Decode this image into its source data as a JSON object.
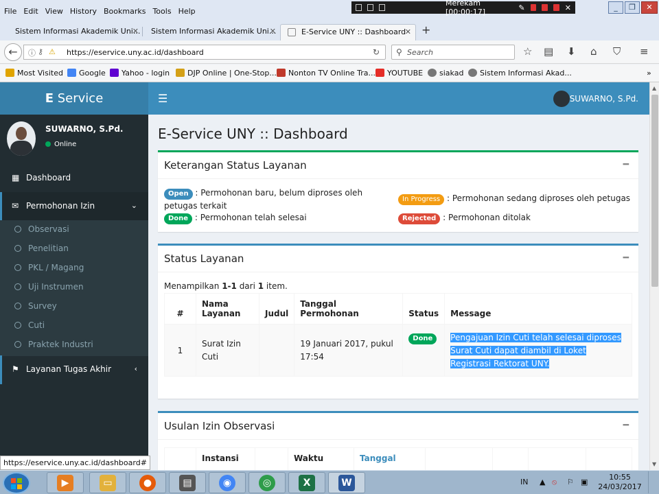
{
  "browser": {
    "menu": [
      "File",
      "Edit",
      "View",
      "History",
      "Bookmarks",
      "Tools",
      "Help"
    ],
    "recorder_title": "Merekam [00:00:17]",
    "tabs": [
      {
        "label": "Sistem Informasi Akademik Uni...",
        "active": false
      },
      {
        "label": "Sistem Informasi Akademik Uni...",
        "active": false
      },
      {
        "label": "E-Service UNY :: Dashboard",
        "active": true
      }
    ],
    "new_tab": "+",
    "url": "https://eservice.uny.ac.id/dashboard",
    "search_placeholder": "Search",
    "bookmarks": [
      {
        "label": "Most Visited",
        "icon": "bookmark-star-icon",
        "color": "#e0a400"
      },
      {
        "label": "Google",
        "icon": "google-icon",
        "color": "#4285f4"
      },
      {
        "label": "Yahoo - login",
        "icon": "yahoo-icon",
        "color": "#5f01d1"
      },
      {
        "label": "DJP Online | One-Stop...",
        "icon": "djp-icon",
        "color": "#d4a017"
      },
      {
        "label": "Nonton TV Online Tra...",
        "icon": "tv-icon",
        "color": "#c0392b"
      },
      {
        "label": "YOUTUBE",
        "icon": "youtube-icon",
        "color": "#e52d27"
      },
      {
        "label": "siakad",
        "icon": "globe-icon",
        "color": "#777"
      },
      {
        "label": "Sistem Informasi Akad...",
        "icon": "globe-icon",
        "color": "#777"
      }
    ],
    "overflow": "»",
    "status_url": "https://eservice.uny.ac.id/dashboard#"
  },
  "app": {
    "logo_bold": "E",
    "logo_rest": " Service",
    "header_user": "SUWARNO, S.Pd.",
    "colors": {
      "header": "#3c8dbc",
      "logo": "#367fa9",
      "sidebar": "#222d32",
      "success": "#00a65a",
      "warning": "#f39c12",
      "danger": "#dd4b39"
    }
  },
  "sidebar": {
    "user_name": "SUWARNO, S.Pd.",
    "user_status": "Online",
    "items": [
      {
        "label": "Dashboard",
        "icon": "dashboard-icon"
      },
      {
        "label": "Permohonan Izin",
        "icon": "envelope-icon"
      },
      {
        "label": "Layanan Tugas Akhir",
        "icon": "flag-icon"
      }
    ],
    "submenu": [
      "Observasi",
      "Penelitian",
      "PKL / Magang",
      "Uji Instrumen",
      "Survey",
      "Cuti",
      "Praktek Industri"
    ]
  },
  "main": {
    "title": "E-Service UNY :: Dashboard",
    "legend_box": {
      "title": "Keterangan Status Layanan",
      "items": [
        {
          "badge": "Open",
          "text": ": Permohonan baru, belum diproses oleh petugas terkait"
        },
        {
          "badge": "In Progress",
          "text": ": Permohonan sedang diproses oleh petugas"
        },
        {
          "badge": "Done",
          "text": ": Permohonan telah selesai"
        },
        {
          "badge": "Rejected",
          "text": ": Permohonan ditolak"
        }
      ]
    },
    "status_box": {
      "title": "Status Layanan",
      "summary_prefix": "Menampilkan ",
      "summary_range": "1-1",
      "summary_mid": " dari ",
      "summary_total": "1",
      "summary_suffix": " item.",
      "columns": [
        "#",
        "Nama Layanan",
        "Judul",
        "Tanggal Permohonan",
        "Status",
        "Message"
      ],
      "rows": [
        {
          "no": "1",
          "nama": "Surat Izin Cuti",
          "judul": "",
          "tanggal": "19 Januari 2017, pukul 17:54",
          "status": "Done",
          "message": "Pengajuan Izin Cuti telah selesai diproses Surat Cuti dapat diambil di Loket Registrasi Rektorat UNY."
        }
      ]
    },
    "observasi_box": {
      "title": "Usulan Izin Observasi",
      "columns": [
        "#",
        "Instansi",
        "",
        "Waktu",
        "Tanggal",
        "",
        "",
        "",
        ""
      ]
    }
  },
  "taskbar": {
    "apps": [
      {
        "name": "media-player",
        "icon": "media-player-icon",
        "color": "#e67e22"
      },
      {
        "name": "explorer",
        "icon": "folder-icon",
        "color": "#e2b13c"
      },
      {
        "name": "firefox",
        "icon": "firefox-icon",
        "color": "#e55b0a"
      },
      {
        "name": "document",
        "icon": "document-icon",
        "color": "#555"
      },
      {
        "name": "chrome",
        "icon": "chrome-icon",
        "color": "#4285f4"
      },
      {
        "name": "recorder",
        "icon": "recorder-icon",
        "color": "#2e9c4a"
      },
      {
        "name": "excel",
        "icon": "excel-icon",
        "color": "#1e7145"
      },
      {
        "name": "word",
        "icon": "word-icon",
        "color": "#2b579a"
      }
    ],
    "language": "IN",
    "time": "10:55",
    "date": "24/03/2017"
  }
}
